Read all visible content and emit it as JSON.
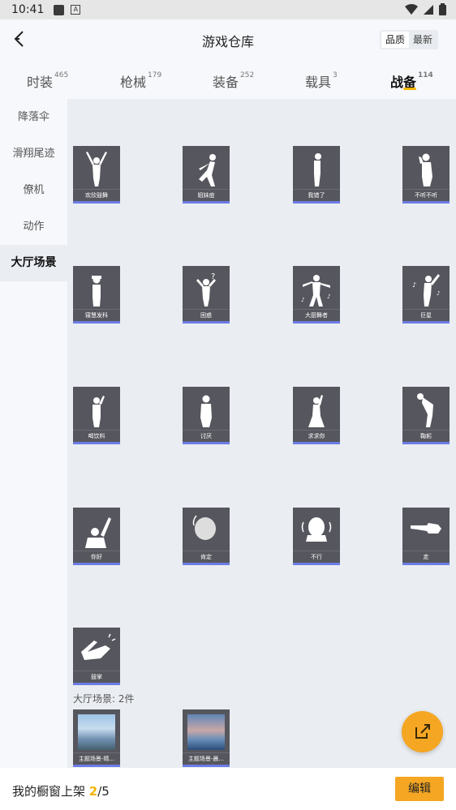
{
  "status": {
    "time": "10:41"
  },
  "header": {
    "title": "游戏仓库",
    "sort_quality": "品质",
    "sort_newest": "最新"
  },
  "tabs": [
    {
      "label": "时装",
      "count": "465"
    },
    {
      "label": "枪械",
      "count": "179"
    },
    {
      "label": "装备",
      "count": "252"
    },
    {
      "label": "载具",
      "count": "3"
    },
    {
      "label": "战备",
      "count": "114"
    }
  ],
  "sidebar": {
    "items": [
      "降落伞",
      "滑翔尾迹",
      "僚机",
      "动作",
      "大厅场景"
    ]
  },
  "actions": [
    {
      "label": "欢欣鼓舞",
      "icon": "arms-raised-figure-icon"
    },
    {
      "label": "姐妹痘",
      "icon": "dancing-figure-icon"
    },
    {
      "label": "我错了",
      "icon": "bowing-figure-icon"
    },
    {
      "label": "不听不听",
      "icon": "covering-ears-figure-icon"
    },
    {
      "label": "寝慧发科",
      "icon": "hands-on-head-figure-icon"
    },
    {
      "label": "困惑",
      "icon": "confused-figure-icon"
    },
    {
      "label": "大厨舞者",
      "icon": "dancer-figure-icon"
    },
    {
      "label": "巨星",
      "icon": "superstar-figure-icon"
    },
    {
      "label": "喝饮料",
      "icon": "drinking-figure-icon"
    },
    {
      "label": "讨厌",
      "icon": "dislike-figure-icon"
    },
    {
      "label": "求求你",
      "icon": "begging-figure-icon"
    },
    {
      "label": "鞠躬",
      "icon": "bow-figure-icon"
    },
    {
      "label": "你好",
      "icon": "waving-figure-icon"
    },
    {
      "label": "肯定",
      "icon": "nodding-head-icon"
    },
    {
      "label": "不行",
      "icon": "shaking-head-icon"
    },
    {
      "label": "走",
      "icon": "pointing-hand-icon"
    },
    {
      "label": "鼓掌",
      "icon": "clapping-hands-icon"
    }
  ],
  "scenes_section": {
    "count_label": "大厅场景: 2件"
  },
  "scenes": [
    {
      "label": "主题场景-晴...",
      "icon": "sky-scene-thumbnail"
    },
    {
      "label": "主题场景-晨...",
      "icon": "sea-scene-thumbnail"
    }
  ],
  "bottom": {
    "shelf_label": "我的橱窗上架",
    "shelf_current": "2",
    "shelf_total": "/5",
    "edit_label": "编辑"
  },
  "colors": {
    "accent": "#f5a623",
    "card_bg": "#56565e",
    "card_underline": "#6b7ce6"
  }
}
